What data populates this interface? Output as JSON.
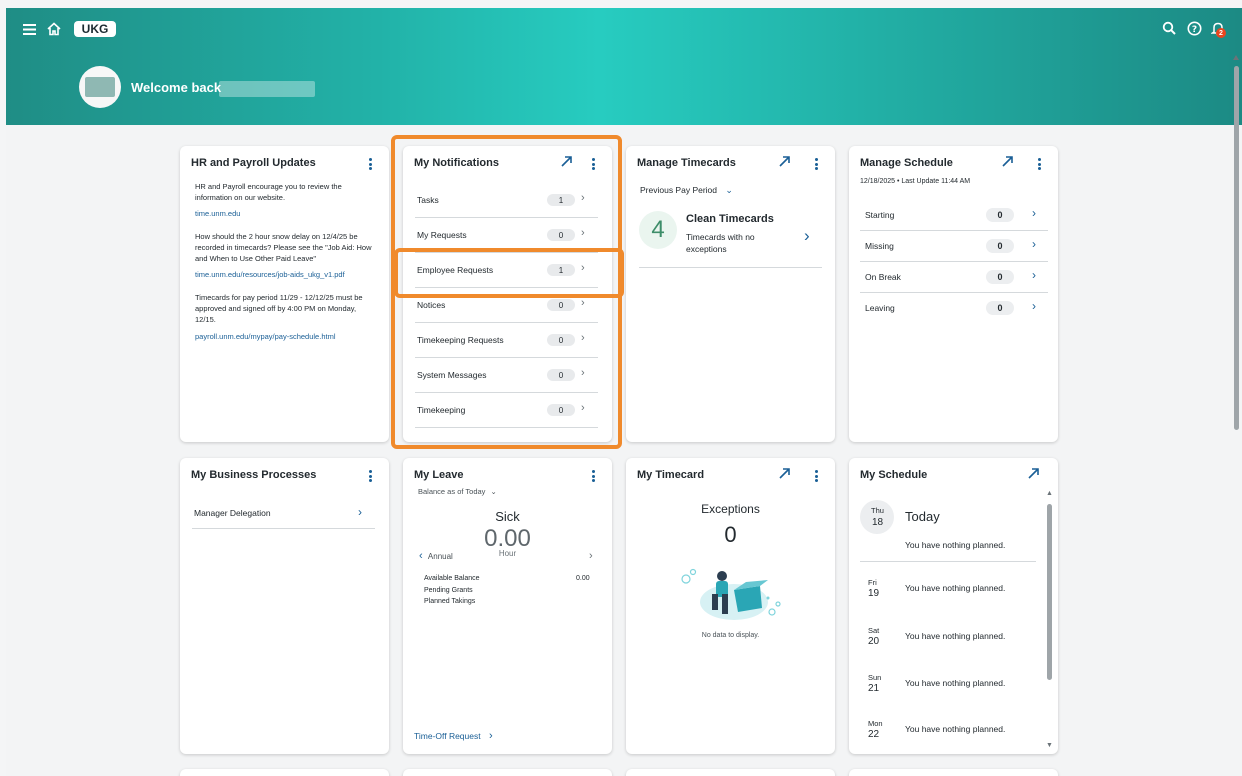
{
  "app": {
    "logo": "UKG"
  },
  "header": {
    "welcome": "Welcome back",
    "notification_count": "2"
  },
  "hr_payroll": {
    "title": "HR and Payroll Updates",
    "p1": "HR and Payroll encourage you to review the information on our website.",
    "link1": "time.unm.edu",
    "p2": "How should the 2 hour snow delay on 12/4/25 be recorded in timecards? Please see the \"Job Aid: How and When to Use Other Paid Leave\"",
    "link2": "time.unm.edu/resources/job-aids_ukg_v1.pdf",
    "p3": "Timecards for pay period 11/29 - 12/12/25 must be approved and signed off by 4:00 PM on Monday, 12/15.",
    "link3": "payroll.unm.edu/mypay/pay-schedule.html"
  },
  "notifications": {
    "title": "My Notifications",
    "rows": [
      {
        "label": "Tasks",
        "count": "1"
      },
      {
        "label": "My Requests",
        "count": "0"
      },
      {
        "label": "Employee Requests",
        "count": "1"
      },
      {
        "label": "Notices",
        "count": "0"
      },
      {
        "label": "Timekeeping Requests",
        "count": "0"
      },
      {
        "label": "System Messages",
        "count": "0"
      },
      {
        "label": "Timekeeping",
        "count": "0"
      }
    ]
  },
  "manage_timecards": {
    "title": "Manage Timecards",
    "period": "Previous Pay Period",
    "count": "4",
    "heading": "Clean Timecards",
    "sub": "Timecards with no exceptions"
  },
  "manage_schedule": {
    "title": "Manage Schedule",
    "updated": "12/18/2025 • Last Update 11:44 AM",
    "rows": [
      {
        "label": "Starting",
        "count": "0"
      },
      {
        "label": "Missing",
        "count": "0"
      },
      {
        "label": "On Break",
        "count": "0"
      },
      {
        "label": "Leaving",
        "count": "0"
      }
    ]
  },
  "business": {
    "title": "My Business Processes",
    "item": "Manager Delegation"
  },
  "leave": {
    "title": "My Leave",
    "balance_as_of": "Balance as of Today",
    "type": "Sick",
    "amount": "0.00",
    "unit": "Hour",
    "prev": "Annual",
    "available_label": "Available Balance",
    "available_value": "0.00",
    "pending": "Pending Grants",
    "planned": "Planned Takings",
    "request_link": "Time-Off Request"
  },
  "timecard": {
    "title": "My Timecard",
    "label": "Exceptions",
    "value": "0",
    "empty": "No data to display."
  },
  "schedule": {
    "title": "My Schedule",
    "today_label": "Today",
    "days": [
      {
        "name": "Thu",
        "num": "18",
        "text": "You have nothing planned."
      },
      {
        "name": "Fri",
        "num": "19",
        "text": "You have nothing planned."
      },
      {
        "name": "Sat",
        "num": "20",
        "text": "You have nothing planned."
      },
      {
        "name": "Sun",
        "num": "21",
        "text": "You have nothing planned."
      },
      {
        "name": "Mon",
        "num": "22",
        "text": "You have nothing planned."
      }
    ]
  }
}
